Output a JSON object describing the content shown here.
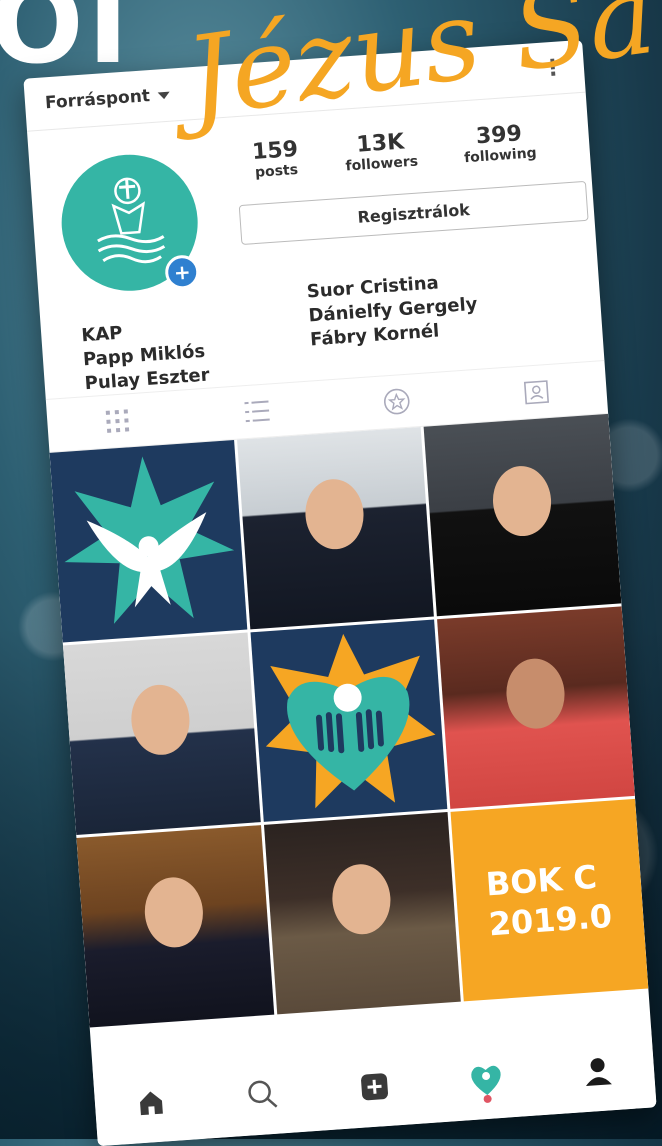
{
  "background": {
    "big_letters": "OI",
    "script_word": "Jézus Sa"
  },
  "header": {
    "account_name": "Forráspont",
    "more_icon": "⋮"
  },
  "profile": {
    "avatar": "kap-logo-icon",
    "stats": [
      {
        "value": "159",
        "label": "posts"
      },
      {
        "value": "13K",
        "label": "followers"
      },
      {
        "value": "399",
        "label": "following"
      }
    ],
    "button_label": "Regisztrálok",
    "names_left": [
      "KAP",
      "Papp Miklós",
      "Pulay Eszter"
    ],
    "names_right": [
      "Suor Cristina",
      "Dánielfy Gergely",
      "Fábry Kornél"
    ]
  },
  "tabs": [
    "grid-icon",
    "list-icon",
    "star-icon",
    "tagged-icon"
  ],
  "promo": {
    "line1": "BOK C",
    "line2": "2019.0"
  },
  "nav": [
    "home-icon",
    "search-icon",
    "add-icon",
    "heart-logo-icon",
    "profile-icon"
  ],
  "colors": {
    "teal": "#35b5a5",
    "navy": "#1e3a5f",
    "orange": "#f6a623",
    "badge_blue": "#2f80d0",
    "accent_red": "#e05563"
  }
}
